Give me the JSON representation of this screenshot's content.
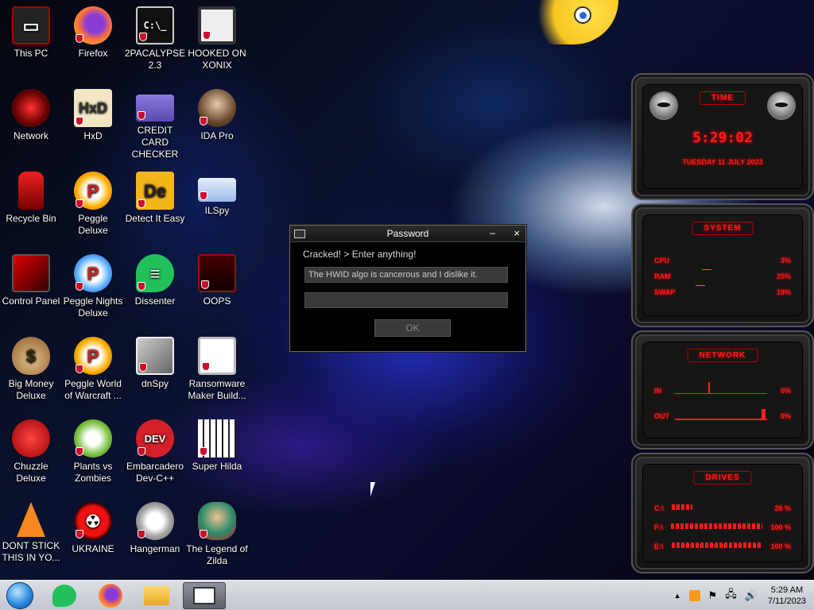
{
  "desktop_icons": [
    {
      "label": "This PC"
    },
    {
      "label": "Firefox"
    },
    {
      "label": "2PACALYPSE 2.3"
    },
    {
      "label": "HOOKED ON XONIX"
    },
    {
      "label": "Network"
    },
    {
      "label": "HxD"
    },
    {
      "label": "CREDIT CARD CHECKER"
    },
    {
      "label": "IDA Pro"
    },
    {
      "label": "Recycle Bin"
    },
    {
      "label": "Peggle Deluxe"
    },
    {
      "label": "Detect It Easy"
    },
    {
      "label": "ILSpy"
    },
    {
      "label": "Control Panel"
    },
    {
      "label": "Peggle Nights Deluxe"
    },
    {
      "label": "Dissenter"
    },
    {
      "label": "OOPS"
    },
    {
      "label": "Big Money Deluxe"
    },
    {
      "label": "Peggle World of Warcraft ..."
    },
    {
      "label": "dnSpy"
    },
    {
      "label": "Ransomware Maker Build..."
    },
    {
      "label": "Chuzzle Deluxe"
    },
    {
      "label": "Plants vs Zombies"
    },
    {
      "label": "Embarcadero Dev-C++"
    },
    {
      "label": "Super Hilda"
    },
    {
      "label": "DONT STICK THIS IN YO..."
    },
    {
      "label": "UKRAINE"
    },
    {
      "label": "Hangerman"
    },
    {
      "label": "The Legend of Zilda"
    }
  ],
  "dialog": {
    "title": "Password",
    "minimize": "–",
    "close": "×",
    "message": "Cracked! > Enter anything!",
    "field1_value": "The HWID algo is cancerous and I dislike it.",
    "field2_value": "",
    "ok_label": "OK"
  },
  "widgets": {
    "time": {
      "header": "TIME",
      "clock": "5:29:02",
      "date": "TUESDAY 11 JULY 2023"
    },
    "system": {
      "header": "SYSTEM",
      "rows": [
        {
          "label": "CPU",
          "value": "3%"
        },
        {
          "label": "RAM",
          "value": "25%"
        },
        {
          "label": "SWAP",
          "value": "19%"
        }
      ]
    },
    "network": {
      "header": "NETWORK",
      "rows": [
        {
          "label": "IN",
          "value": "0%"
        },
        {
          "label": "OUT",
          "value": "0%"
        }
      ]
    },
    "drives": {
      "header": "DRIVES",
      "rows": [
        {
          "label": "C:\\",
          "value": "26 %"
        },
        {
          "label": "F:\\",
          "value": "100 %"
        },
        {
          "label": "E:\\",
          "value": "100 %"
        }
      ]
    }
  },
  "taskbar": {
    "clock_time": "5:29 AM",
    "clock_date": "7/11/2023",
    "tray_chevron": "▲"
  }
}
